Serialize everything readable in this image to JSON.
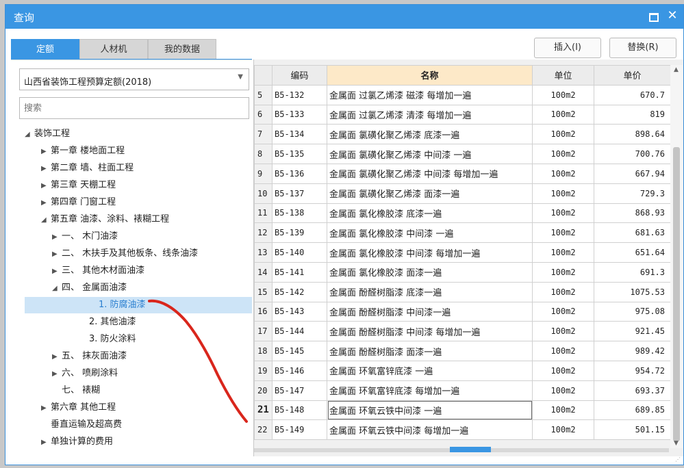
{
  "window": {
    "title": "查询"
  },
  "tabs": [
    {
      "label": "定额",
      "active": true
    },
    {
      "label": "人材机",
      "active": false
    },
    {
      "label": "我的数据",
      "active": false
    }
  ],
  "buttons": {
    "insert": "插入(I)",
    "replace": "替换(R)"
  },
  "library_select": {
    "value": "山西省装饰工程预算定额(2018)"
  },
  "search": {
    "placeholder": "搜索"
  },
  "tree": [
    {
      "label": "装饰工程",
      "caret": "◢"
    },
    {
      "label": "第一章 楼地面工程",
      "caret": "▶"
    },
    {
      "label": "第二章 墙、柱面工程",
      "caret": "▶"
    },
    {
      "label": "第三章 天棚工程",
      "caret": "▶"
    },
    {
      "label": "第四章 门窗工程",
      "caret": "▶"
    },
    {
      "label": "第五章 油漆、涂料、裱糊工程",
      "caret": "◢"
    },
    {
      "label": "一、 木门油漆",
      "caret": "▶"
    },
    {
      "label": "二、 木扶手及其他板条、线条油漆",
      "caret": "▶"
    },
    {
      "label": "三、 其他木材面油漆",
      "caret": "▶"
    },
    {
      "label": "四、 金属面油漆",
      "caret": "◢"
    },
    {
      "label": "1. 防腐油漆",
      "caret": "",
      "selected": true
    },
    {
      "label": "2. 其他油漆",
      "caret": ""
    },
    {
      "label": "3. 防火涂料",
      "caret": ""
    },
    {
      "label": "五、 抹灰面油漆",
      "caret": "▶"
    },
    {
      "label": "六、 喷刷涂料",
      "caret": "▶"
    },
    {
      "label": "七、 裱糊",
      "caret": ""
    },
    {
      "label": "第六章 其他工程",
      "caret": "▶"
    },
    {
      "label": "垂直运输及超高费",
      "caret": ""
    },
    {
      "label": "单独计算的费用",
      "caret": "▶"
    }
  ],
  "table": {
    "columns": [
      "编码",
      "名称",
      "单位",
      "单价"
    ],
    "rows": [
      {
        "n": "5",
        "code": "B5-132",
        "name": "金属面 过氯乙烯漆 磁漆 每增加一遍",
        "unit": "100m2",
        "price": "670.7"
      },
      {
        "n": "6",
        "code": "B5-133",
        "name": "金属面 过氯乙烯漆 清漆 每增加一遍",
        "unit": "100m2",
        "price": "819"
      },
      {
        "n": "7",
        "code": "B5-134",
        "name": "金属面 氯磺化聚乙烯漆 底漆一遍",
        "unit": "100m2",
        "price": "898.64"
      },
      {
        "n": "8",
        "code": "B5-135",
        "name": "金属面 氯磺化聚乙烯漆 中间漆 一遍",
        "unit": "100m2",
        "price": "700.76"
      },
      {
        "n": "9",
        "code": "B5-136",
        "name": "金属面 氯磺化聚乙烯漆 中间漆 每增加一遍",
        "unit": "100m2",
        "price": "667.94"
      },
      {
        "n": "10",
        "code": "B5-137",
        "name": "金属面 氯磺化聚乙烯漆 面漆一遍",
        "unit": "100m2",
        "price": "729.3"
      },
      {
        "n": "11",
        "code": "B5-138",
        "name": "金属面 氯化橡胶漆 底漆一遍",
        "unit": "100m2",
        "price": "868.93"
      },
      {
        "n": "12",
        "code": "B5-139",
        "name": "金属面 氯化橡胶漆 中间漆 一遍",
        "unit": "100m2",
        "price": "681.63"
      },
      {
        "n": "13",
        "code": "B5-140",
        "name": "金属面 氯化橡胶漆 中间漆 每增加一遍",
        "unit": "100m2",
        "price": "651.64"
      },
      {
        "n": "14",
        "code": "B5-141",
        "name": "金属面 氯化橡胶漆 面漆一遍",
        "unit": "100m2",
        "price": "691.3"
      },
      {
        "n": "15",
        "code": "B5-142",
        "name": "金属面 酚醛树脂漆 底漆一遍",
        "unit": "100m2",
        "price": "1075.53"
      },
      {
        "n": "16",
        "code": "B5-143",
        "name": "金属面 酚醛树脂漆 中间漆一遍",
        "unit": "100m2",
        "price": "975.08"
      },
      {
        "n": "17",
        "code": "B5-144",
        "name": "金属面 酚醛树脂漆 中间漆 每增加一遍",
        "unit": "100m2",
        "price": "921.45"
      },
      {
        "n": "18",
        "code": "B5-145",
        "name": "金属面 酚醛树脂漆 面漆一遍",
        "unit": "100m2",
        "price": "989.42"
      },
      {
        "n": "19",
        "code": "B5-146",
        "name": "金属面 环氧富锌底漆 一遍",
        "unit": "100m2",
        "price": "954.72"
      },
      {
        "n": "20",
        "code": "B5-147",
        "name": "金属面 环氧富锌底漆 每增加一遍",
        "unit": "100m2",
        "price": "693.37"
      },
      {
        "n": "21",
        "code": "B5-148",
        "name": "金属面 环氧云铁中间漆 一遍",
        "unit": "100m2",
        "price": "689.85",
        "active": true
      },
      {
        "n": "22",
        "code": "B5-149",
        "name": "金属面 环氧云铁中间漆 每增加一遍",
        "unit": "100m2",
        "price": "501.15"
      }
    ]
  },
  "colors": {
    "accent": "#3a96e3",
    "annotation": "#d9261c",
    "header_highlight": "#fde9c8",
    "selection": "#cde4f7"
  },
  "icons": {
    "maximize": "maximize-icon",
    "close": "close-icon",
    "dropdown": "chevron-down-icon"
  }
}
